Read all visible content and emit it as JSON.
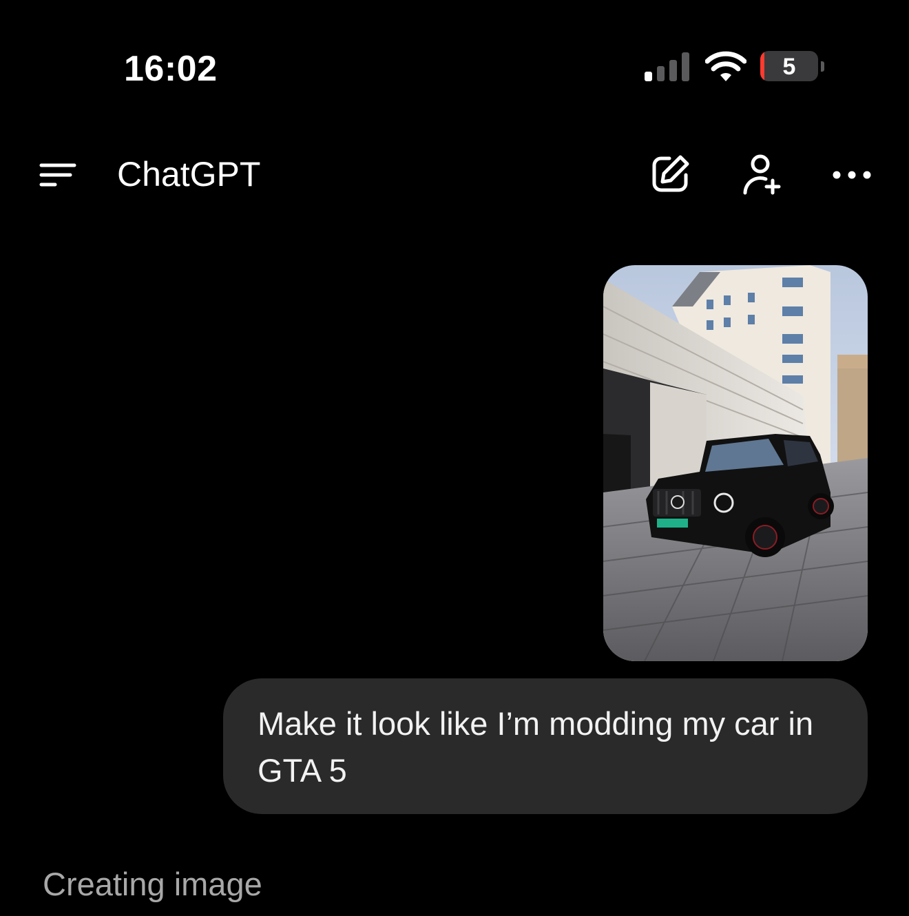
{
  "status_bar": {
    "time": "16:02",
    "battery_level": "5",
    "battery_color": "#ff3b30"
  },
  "header": {
    "menu_icon": "menu-icon",
    "title": "ChatGPT",
    "compose_icon": "new-chat-icon",
    "add_user_icon": "add-user-icon",
    "more_icon": "more-icon"
  },
  "conversation": {
    "attachment": {
      "kind": "photo",
      "description_icon": "car-photo"
    },
    "user_message": "Make it look like I’m modding my car in GTA 5",
    "assistant_status": "Creating image"
  },
  "colors": {
    "background": "#000000",
    "bubble": "#2a2a2a",
    "status_text": "#a8a8a8"
  }
}
